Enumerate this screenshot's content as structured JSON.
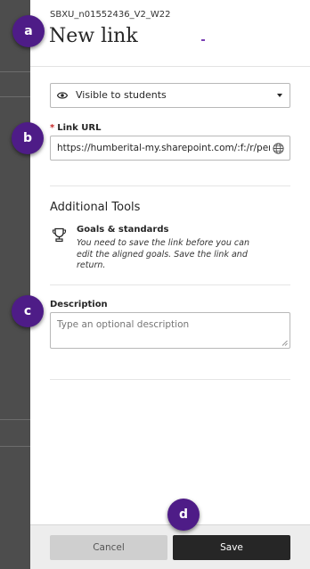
{
  "header": {
    "course_id": "SBXU_n01552436_V2_W22",
    "title": "New link"
  },
  "visibility": {
    "selected": "Visible to students",
    "icon": "eye-icon"
  },
  "link_url": {
    "label": "Link URL",
    "required_marker": "*",
    "value": "https://humberital-my.sharepoint.com/:f:/r/persc",
    "icon": "globe-icon"
  },
  "additional_tools": {
    "title": "Additional Tools",
    "goals": {
      "icon": "trophy-icon",
      "title": "Goals & standards",
      "text": "You need to save the link before you can edit the aligned goals. Save the link and return."
    }
  },
  "description": {
    "label": "Description",
    "placeholder": "Type an optional description"
  },
  "footer": {
    "cancel_label": "Cancel",
    "save_label": "Save"
  },
  "badges": {
    "a": "a",
    "b": "b",
    "c": "c",
    "d": "d"
  },
  "colors": {
    "badge": "#4e1c87",
    "save_button": "#262626",
    "cancel_button": "#cfcfcf",
    "required": "#c62828"
  }
}
